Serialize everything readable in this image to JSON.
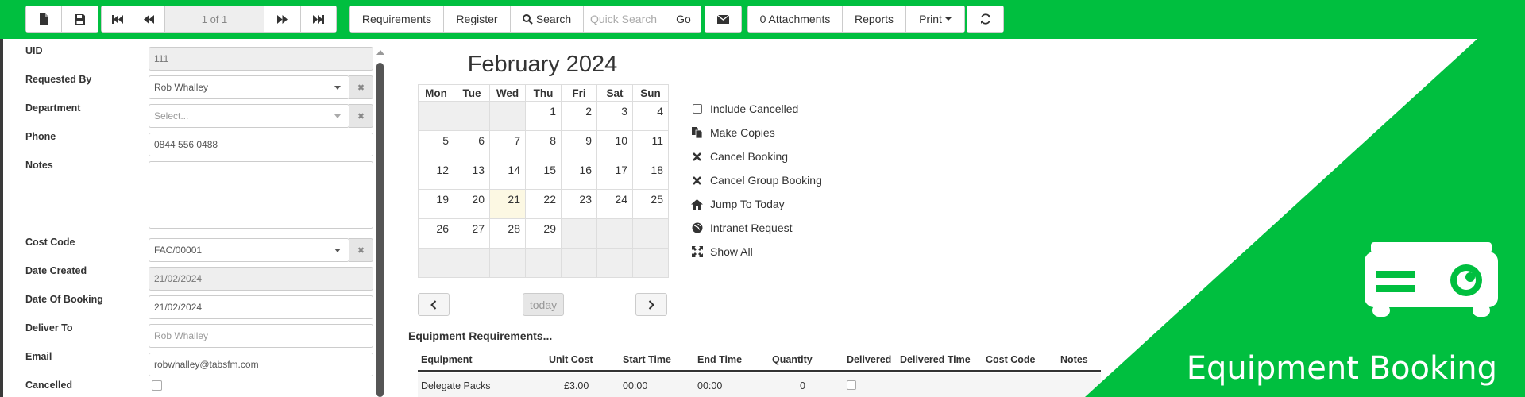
{
  "toolbar": {
    "pager_label": "1 of 1",
    "requirements_label": "Requirements",
    "register_label": "Register",
    "search_label": "Search",
    "quick_search_placeholder": "Quick Search",
    "go_label": "Go",
    "attachments_label": "0 Attachments",
    "reports_label": "Reports",
    "print_label": "Print"
  },
  "form": {
    "uid": {
      "label": "UID",
      "value": "111"
    },
    "requested_by": {
      "label": "Requested By",
      "value": "Rob Whalley"
    },
    "department": {
      "label": "Department",
      "placeholder": "Select..."
    },
    "phone": {
      "label": "Phone",
      "value": "0844 556 0488"
    },
    "notes": {
      "label": "Notes",
      "value": ""
    },
    "cost_code": {
      "label": "Cost Code",
      "value": "FAC/00001"
    },
    "date_created": {
      "label": "Date Created",
      "value": "21/02/2024"
    },
    "date_of_booking": {
      "label": "Date Of Booking",
      "value": "21/02/2024"
    },
    "deliver_to": {
      "label": "Deliver To",
      "placeholder": "Rob Whalley"
    },
    "email": {
      "label": "Email",
      "value": "robwhalley@tabsfm.com"
    },
    "cancelled": {
      "label": "Cancelled",
      "checked": false
    }
  },
  "calendar": {
    "title": "February 2024",
    "weekdays": [
      "Mon",
      "Tue",
      "Wed",
      "Thu",
      "Fri",
      "Sat",
      "Sun"
    ],
    "weeks": [
      [
        "",
        "",
        "",
        "1",
        "2",
        "3",
        "4"
      ],
      [
        "5",
        "6",
        "7",
        "8",
        "9",
        "10",
        "11"
      ],
      [
        "12",
        "13",
        "14",
        "15",
        "16",
        "17",
        "18"
      ],
      [
        "19",
        "20",
        "21",
        "22",
        "23",
        "24",
        "25"
      ],
      [
        "26",
        "27",
        "28",
        "29",
        "",
        "",
        ""
      ],
      [
        "",
        "",
        "",
        "",
        "",
        "",
        ""
      ]
    ],
    "today": "21",
    "today_button": "today"
  },
  "actions": [
    {
      "label": "Include Cancelled",
      "icon": "checkbox-icon"
    },
    {
      "label": "Make Copies",
      "icon": "copy-icon"
    },
    {
      "label": "Cancel Booking",
      "icon": "close-icon"
    },
    {
      "label": "Cancel Group Booking",
      "icon": "close-icon"
    },
    {
      "label": "Jump To Today",
      "icon": "home-icon"
    },
    {
      "label": "Intranet Request",
      "icon": "globe-icon"
    },
    {
      "label": "Show All",
      "icon": "fullscreen-icon"
    }
  ],
  "equipment": {
    "title": "Equipment Requirements...",
    "columns": [
      "Equipment",
      "Unit Cost",
      "Start Time",
      "End Time",
      "Quantity",
      "Delivered",
      "Delivered Time",
      "Cost Code",
      "Notes"
    ],
    "rows": [
      {
        "equipment": "Delegate Packs",
        "unit_cost": "£3.00",
        "start_time": "00:00",
        "end_time": "00:00",
        "quantity": "0",
        "delivered": false,
        "delivered_time": "",
        "cost_code": "",
        "notes": ""
      }
    ]
  },
  "brand": {
    "title": "Equipment Booking",
    "icon": "projector-icon",
    "color": "#00bf3f"
  }
}
